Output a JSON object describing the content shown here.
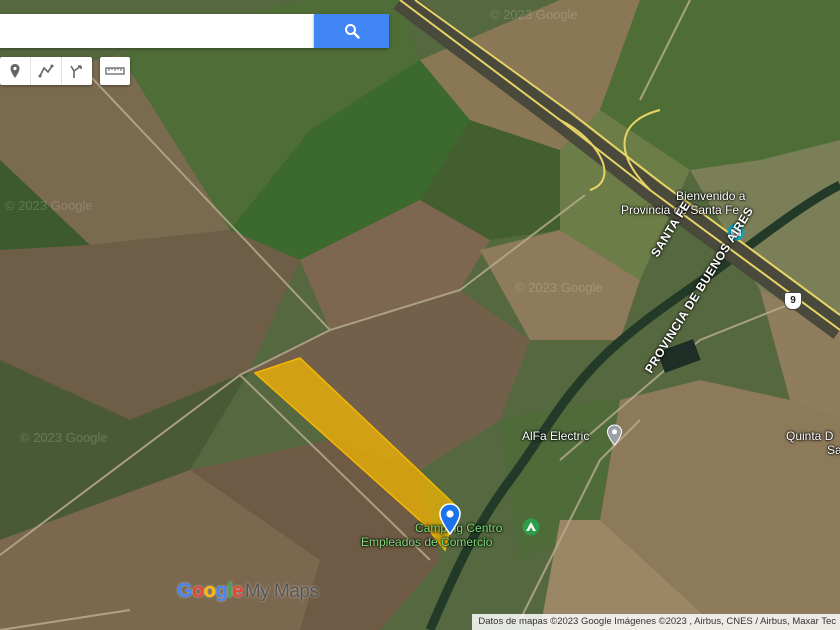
{
  "search": {
    "placeholder": "",
    "button_icon": "search-icon"
  },
  "toolbar": {
    "tools": [
      "marker-icon",
      "draw-line-icon",
      "directions-icon"
    ],
    "measure_tool": "ruler-icon"
  },
  "places": {
    "welcome_line1": "Bienvenido a",
    "welcome_line2": "Provincia de Santa Fe",
    "alfa": "AlFa Electric",
    "quinta_line1": "Quinta D",
    "quinta_line2": "Sa",
    "camping_line1": "Camping Centro",
    "camping_line2": "Empleados de Comercio"
  },
  "roads": {
    "border_label_1": "SANTA FE",
    "border_label_2": "PROVINCIA DE BUENOS AIRES",
    "route_shield": "9"
  },
  "watermark": "© 2023 Google",
  "logo": {
    "google": [
      "G",
      "o",
      "o",
      "g",
      "l",
      "e"
    ],
    "suffix": "My Maps"
  },
  "attribution": "Datos de mapas ©2023 Google Imágenes ©2023 , Airbus, CNES / Airbus, Maxar Tec",
  "colors": {
    "highlight_polygon": "#f5b800",
    "marker": "#1a73e8",
    "search_button": "#4285f4"
  }
}
